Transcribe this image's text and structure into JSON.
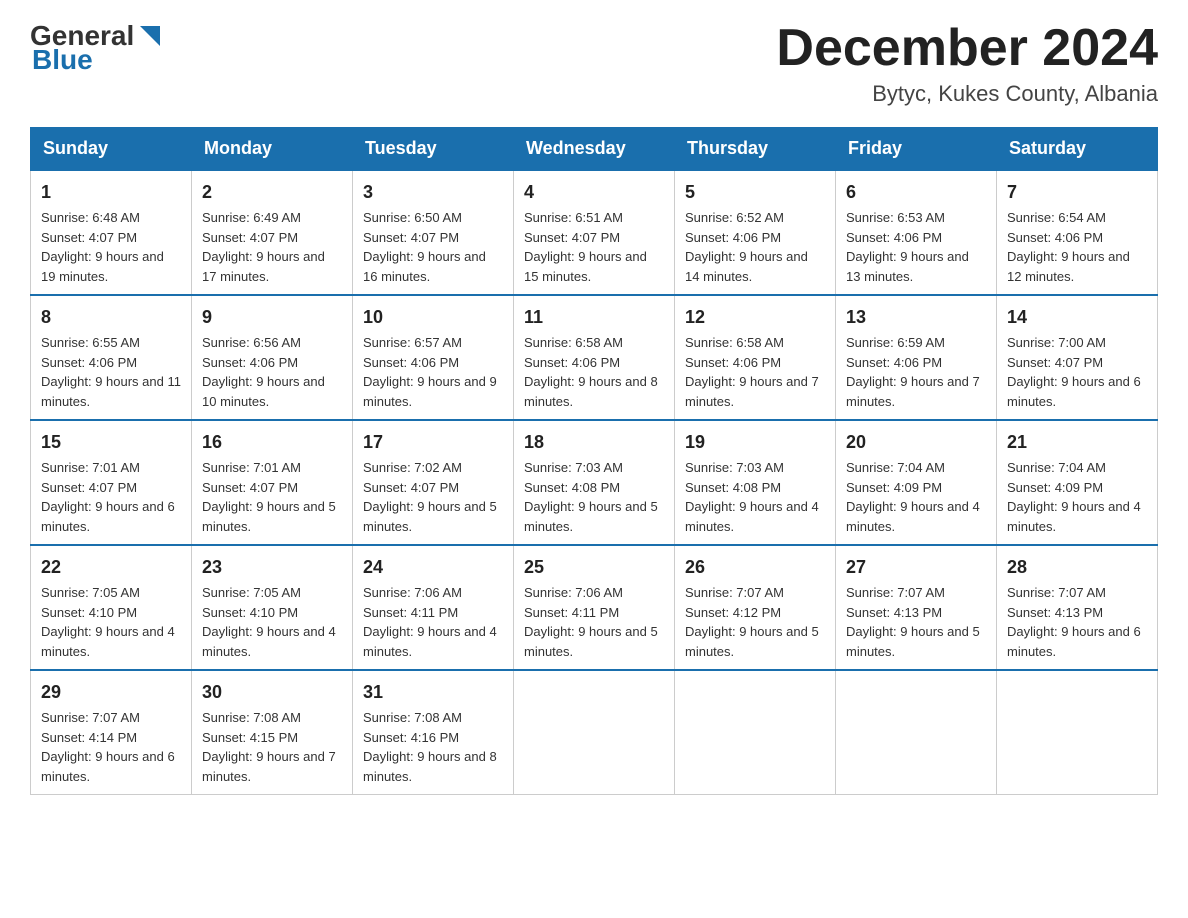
{
  "header": {
    "logo_general": "General",
    "logo_blue": "Blue",
    "month_title": "December 2024",
    "location": "Bytyc, Kukes County, Albania"
  },
  "days_of_week": [
    "Sunday",
    "Monday",
    "Tuesday",
    "Wednesday",
    "Thursday",
    "Friday",
    "Saturday"
  ],
  "weeks": [
    [
      {
        "day": "1",
        "sunrise": "6:48 AM",
        "sunset": "4:07 PM",
        "daylight": "9 hours and 19 minutes."
      },
      {
        "day": "2",
        "sunrise": "6:49 AM",
        "sunset": "4:07 PM",
        "daylight": "9 hours and 17 minutes."
      },
      {
        "day": "3",
        "sunrise": "6:50 AM",
        "sunset": "4:07 PM",
        "daylight": "9 hours and 16 minutes."
      },
      {
        "day": "4",
        "sunrise": "6:51 AM",
        "sunset": "4:07 PM",
        "daylight": "9 hours and 15 minutes."
      },
      {
        "day": "5",
        "sunrise": "6:52 AM",
        "sunset": "4:06 PM",
        "daylight": "9 hours and 14 minutes."
      },
      {
        "day": "6",
        "sunrise": "6:53 AM",
        "sunset": "4:06 PM",
        "daylight": "9 hours and 13 minutes."
      },
      {
        "day": "7",
        "sunrise": "6:54 AM",
        "sunset": "4:06 PM",
        "daylight": "9 hours and 12 minutes."
      }
    ],
    [
      {
        "day": "8",
        "sunrise": "6:55 AM",
        "sunset": "4:06 PM",
        "daylight": "9 hours and 11 minutes."
      },
      {
        "day": "9",
        "sunrise": "6:56 AM",
        "sunset": "4:06 PM",
        "daylight": "9 hours and 10 minutes."
      },
      {
        "day": "10",
        "sunrise": "6:57 AM",
        "sunset": "4:06 PM",
        "daylight": "9 hours and 9 minutes."
      },
      {
        "day": "11",
        "sunrise": "6:58 AM",
        "sunset": "4:06 PM",
        "daylight": "9 hours and 8 minutes."
      },
      {
        "day": "12",
        "sunrise": "6:58 AM",
        "sunset": "4:06 PM",
        "daylight": "9 hours and 7 minutes."
      },
      {
        "day": "13",
        "sunrise": "6:59 AM",
        "sunset": "4:06 PM",
        "daylight": "9 hours and 7 minutes."
      },
      {
        "day": "14",
        "sunrise": "7:00 AM",
        "sunset": "4:07 PM",
        "daylight": "9 hours and 6 minutes."
      }
    ],
    [
      {
        "day": "15",
        "sunrise": "7:01 AM",
        "sunset": "4:07 PM",
        "daylight": "9 hours and 6 minutes."
      },
      {
        "day": "16",
        "sunrise": "7:01 AM",
        "sunset": "4:07 PM",
        "daylight": "9 hours and 5 minutes."
      },
      {
        "day": "17",
        "sunrise": "7:02 AM",
        "sunset": "4:07 PM",
        "daylight": "9 hours and 5 minutes."
      },
      {
        "day": "18",
        "sunrise": "7:03 AM",
        "sunset": "4:08 PM",
        "daylight": "9 hours and 5 minutes."
      },
      {
        "day": "19",
        "sunrise": "7:03 AM",
        "sunset": "4:08 PM",
        "daylight": "9 hours and 4 minutes."
      },
      {
        "day": "20",
        "sunrise": "7:04 AM",
        "sunset": "4:09 PM",
        "daylight": "9 hours and 4 minutes."
      },
      {
        "day": "21",
        "sunrise": "7:04 AM",
        "sunset": "4:09 PM",
        "daylight": "9 hours and 4 minutes."
      }
    ],
    [
      {
        "day": "22",
        "sunrise": "7:05 AM",
        "sunset": "4:10 PM",
        "daylight": "9 hours and 4 minutes."
      },
      {
        "day": "23",
        "sunrise": "7:05 AM",
        "sunset": "4:10 PM",
        "daylight": "9 hours and 4 minutes."
      },
      {
        "day": "24",
        "sunrise": "7:06 AM",
        "sunset": "4:11 PM",
        "daylight": "9 hours and 4 minutes."
      },
      {
        "day": "25",
        "sunrise": "7:06 AM",
        "sunset": "4:11 PM",
        "daylight": "9 hours and 5 minutes."
      },
      {
        "day": "26",
        "sunrise": "7:07 AM",
        "sunset": "4:12 PM",
        "daylight": "9 hours and 5 minutes."
      },
      {
        "day": "27",
        "sunrise": "7:07 AM",
        "sunset": "4:13 PM",
        "daylight": "9 hours and 5 minutes."
      },
      {
        "day": "28",
        "sunrise": "7:07 AM",
        "sunset": "4:13 PM",
        "daylight": "9 hours and 6 minutes."
      }
    ],
    [
      {
        "day": "29",
        "sunrise": "7:07 AM",
        "sunset": "4:14 PM",
        "daylight": "9 hours and 6 minutes."
      },
      {
        "day": "30",
        "sunrise": "7:08 AM",
        "sunset": "4:15 PM",
        "daylight": "9 hours and 7 minutes."
      },
      {
        "day": "31",
        "sunrise": "7:08 AM",
        "sunset": "4:16 PM",
        "daylight": "9 hours and 8 minutes."
      },
      null,
      null,
      null,
      null
    ]
  ]
}
